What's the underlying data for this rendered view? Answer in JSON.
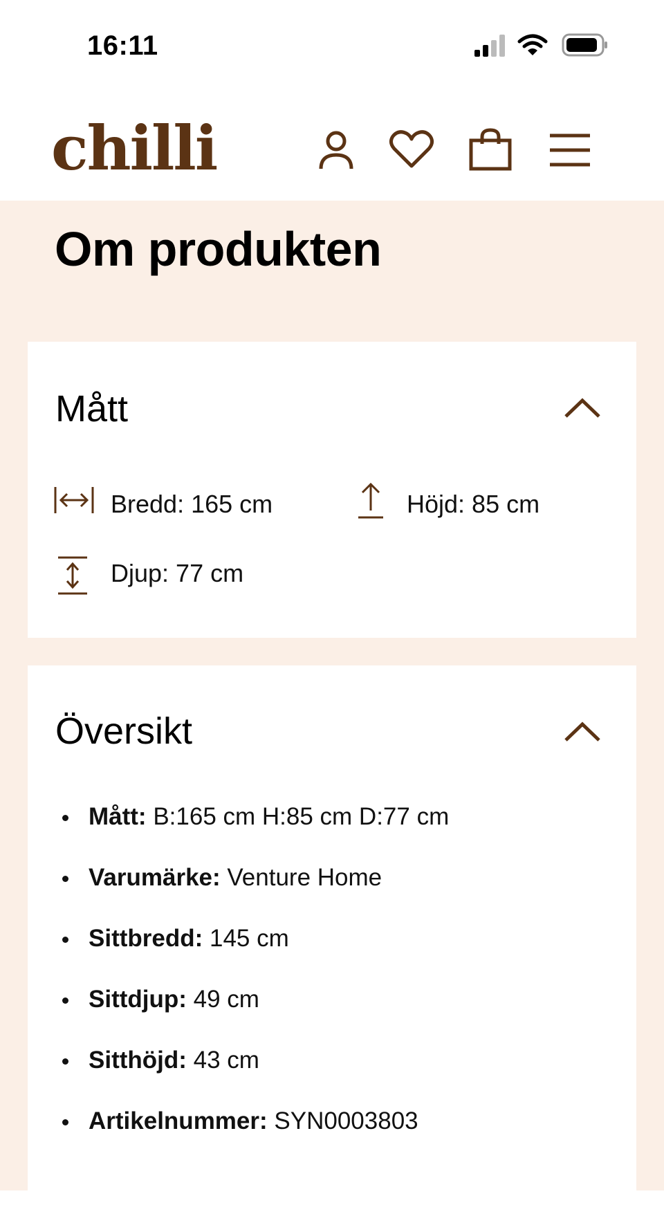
{
  "status_bar": {
    "time": "16:11",
    "icons": [
      "cellular-signal-icon",
      "wifi-icon",
      "battery-icon"
    ]
  },
  "header": {
    "logo": "chilli",
    "icons": [
      "account-icon",
      "heart-icon",
      "shopping-bag-icon",
      "menu-icon"
    ]
  },
  "colors": {
    "brand": "#5b3314",
    "page_background": "#fbefe6",
    "card_background": "#ffffff"
  },
  "main": {
    "title": "Om produkten",
    "dimensions_card": {
      "title": "Mått",
      "items": [
        {
          "icon": "width-arrows-icon",
          "label": "Bredd: 165 cm"
        },
        {
          "icon": "height-arrow-icon",
          "label": "Höjd: 85 cm"
        },
        {
          "icon": "depth-arrows-icon",
          "label": "Djup: 77 cm"
        }
      ]
    },
    "overview_card": {
      "title": "Översikt",
      "items": [
        {
          "key": "Mått:",
          "value": " B:165 cm H:85 cm D:77 cm"
        },
        {
          "key": "Varumärke:",
          "value": " Venture Home"
        },
        {
          "key": "Sittbredd:",
          "value": " 145 cm"
        },
        {
          "key": "Sittdjup:",
          "value": " 49 cm"
        },
        {
          "key": "Sitthöjd:",
          "value": " 43 cm"
        },
        {
          "key": "Artikelnummer:",
          "value": " SYN0003803"
        }
      ]
    }
  }
}
